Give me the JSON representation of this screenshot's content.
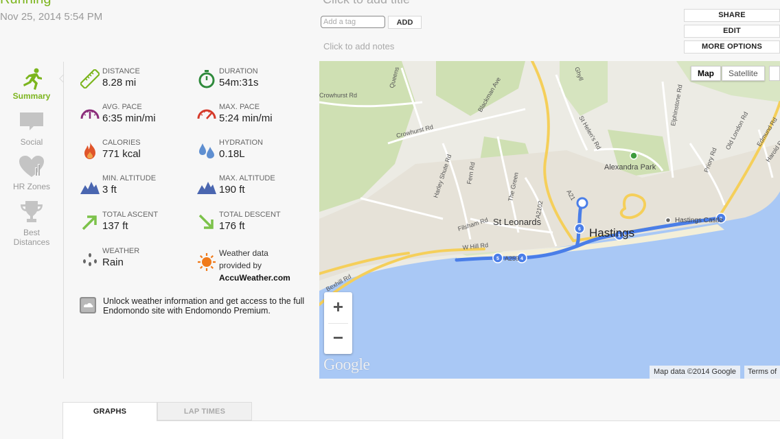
{
  "header": {
    "activity_type": "Running",
    "date": "Nov 25, 2014 5:54 PM",
    "title_placeholder": "Click to add title",
    "tag_placeholder": "Add a tag",
    "add_label": "ADD",
    "notes_placeholder": "Click to add notes"
  },
  "actions": {
    "share": "SHARE",
    "edit": "EDIT",
    "more": "MORE OPTIONS"
  },
  "nav": {
    "summary": "Summary",
    "social": "Social",
    "hr_zones": "HR Zones",
    "best_line1": "Best",
    "best_line2": "Distances"
  },
  "stats": {
    "distance": {
      "label": "DISTANCE",
      "value": "8.28 mi"
    },
    "duration": {
      "label": "DURATION",
      "value": "54m:31s"
    },
    "avg_pace": {
      "label": "AVG. PACE",
      "value": "6:35 min/mi"
    },
    "max_pace": {
      "label": "MAX. PACE",
      "value": "5:24 min/mi"
    },
    "calories": {
      "label": "CALORIES",
      "value": "771 kcal"
    },
    "hydration": {
      "label": "HYDRATION",
      "value": "0.18L"
    },
    "min_alt": {
      "label": "MIN. ALTITUDE",
      "value": "3 ft"
    },
    "max_alt": {
      "label": "MAX. ALTITUDE",
      "value": "190 ft"
    },
    "ascent": {
      "label": "TOTAL ASCENT",
      "value": "137 ft"
    },
    "descent": {
      "label": "TOTAL DESCENT",
      "value": "176 ft"
    },
    "weather": {
      "label": "WEATHER",
      "value": "Rain"
    },
    "weather_credit_1": "Weather data",
    "weather_credit_2": "provided by",
    "weather_credit_3": "AccuWeather.com"
  },
  "unlock_text": "Unlock weather information and get access to the full Endomondo site with Endomondo Premium.",
  "map": {
    "type_map": "Map",
    "type_satellite": "Satellite",
    "zoom_in": "+",
    "zoom_out": "−",
    "logo": "Google",
    "attribution": "Map data ©2014 Google",
    "terms": "Terms of",
    "labels": {
      "queens": "Queens",
      "crowhurst_rd_1": "Crowhurst Rd",
      "crowhurst_rd_2": "Crowhurst Rd",
      "blackman": "Blackman Ave",
      "st_helens": "St Helen's Rd",
      "elphinstone": "Elphinstone Rd",
      "old_london": "Old London Rd",
      "edmund": "Edmund Rd",
      "harold": "Harold Rd",
      "priory": "Priory Rd",
      "alexandra": "Alexandra Park",
      "harley": "Harley Shute Rd",
      "fern": "Fern Rd",
      "green": "The Green",
      "a2102": "A2102",
      "a21": "A21",
      "filsham": "Filsham Rd",
      "st_leonards": "St Leonards",
      "hastings": "Hastings",
      "hastings_castle": "Hastings Castle",
      "w_hill": "W Hill Rd",
      "bexhill": "Bexhill Rd",
      "a259": "A259",
      "ghyll": "Ghyll"
    },
    "markers": [
      "5",
      "4",
      "3",
      "6",
      "2"
    ]
  },
  "tabs": {
    "graphs": "GRAPHS",
    "lap_times": "LAP TIMES"
  },
  "colors": {
    "accent": "#7cb51e",
    "route": "#4a7ee8",
    "sea": "#a9c8f5"
  }
}
